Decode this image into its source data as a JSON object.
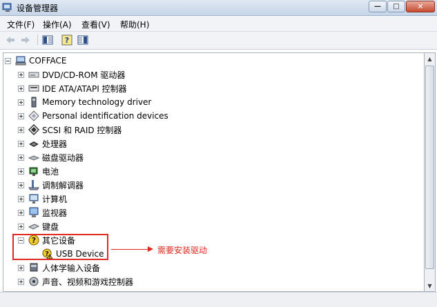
{
  "window": {
    "title": "设备管理器",
    "minimize": "—",
    "maximize": "□",
    "close": "✕"
  },
  "menu": [
    {
      "label": "文件(F)"
    },
    {
      "label": "操作(A)"
    },
    {
      "label": "查看(V)"
    },
    {
      "label": "帮助(H)"
    }
  ],
  "toolbar": {
    "back_icon": "back-arrow-icon",
    "forward_icon": "forward-arrow-icon",
    "props_icon": "properties-icon",
    "help_icon": "help-icon",
    "update_icon": "update-driver-icon"
  },
  "tree": {
    "root": {
      "label": "COFFACE",
      "icon": "computer-icon"
    },
    "items": [
      {
        "label": "DVD/CD-ROM 驱动器",
        "icon": "dvd-drive-icon",
        "expander": "+"
      },
      {
        "label": "IDE ATA/ATAPI 控制器",
        "icon": "ide-controller-icon",
        "expander": "+"
      },
      {
        "label": "Memory technology driver",
        "icon": "memory-icon",
        "expander": "+"
      },
      {
        "label": "Personal identification devices",
        "icon": "id-device-icon",
        "expander": "+"
      },
      {
        "label": "SCSI 和 RAID 控制器",
        "icon": "scsi-icon",
        "expander": "+"
      },
      {
        "label": "处理器",
        "icon": "processor-icon",
        "expander": "+"
      },
      {
        "label": "磁盘驱动器",
        "icon": "disk-drive-icon",
        "expander": "+"
      },
      {
        "label": "电池",
        "icon": "battery-icon",
        "expander": "+"
      },
      {
        "label": "调制解调器",
        "icon": "modem-icon",
        "expander": "+"
      },
      {
        "label": "计算机",
        "icon": "computer-small-icon",
        "expander": "+"
      },
      {
        "label": "监视器",
        "icon": "monitor-icon",
        "expander": "+"
      },
      {
        "label": "键盘",
        "icon": "keyboard-icon",
        "expander": "+"
      },
      {
        "label": "其它设备",
        "icon": "unknown-device-icon",
        "expander": "-"
      },
      {
        "label": "USB Device",
        "icon": "warning-device-icon",
        "expander": ""
      },
      {
        "label": "人体学输入设备",
        "icon": "hid-icon",
        "expander": "+"
      },
      {
        "label": "声音、视频和游戏控制器",
        "icon": "sound-icon",
        "expander": "+"
      }
    ]
  },
  "annotation": {
    "text": "需要安装驱动",
    "color": "#e0281f"
  }
}
